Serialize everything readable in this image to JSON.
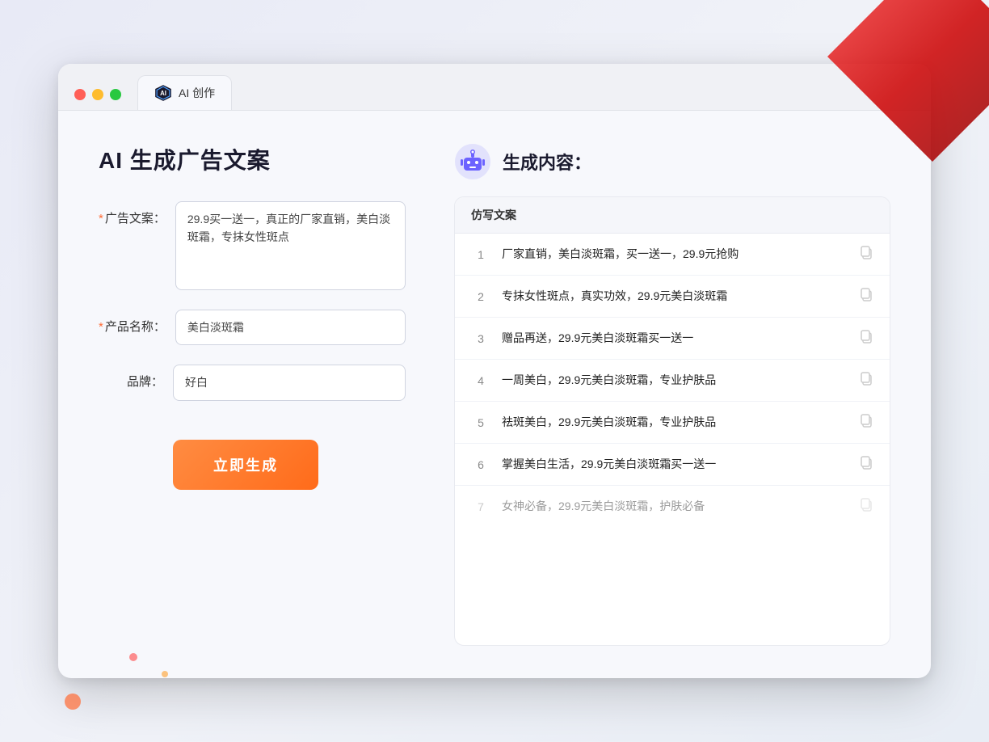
{
  "browser": {
    "tab_title": "AI 创作",
    "traffic_lights": [
      "red",
      "yellow",
      "green"
    ]
  },
  "left_panel": {
    "page_title": "AI 生成广告文案",
    "form": {
      "ad_copy_label": "广告文案：",
      "ad_copy_required": "*",
      "ad_copy_value": "29.9买一送一，真正的厂家直销，美白淡斑霜，专抹女性斑点",
      "product_name_label": "产品名称：",
      "product_name_required": "*",
      "product_name_value": "美白淡斑霜",
      "brand_label": "品牌：",
      "brand_value": "好白"
    },
    "generate_button": "立即生成"
  },
  "right_panel": {
    "title": "生成内容：",
    "table_header": "仿写文案",
    "results": [
      {
        "number": "1",
        "text": "厂家直销，美白淡斑霜，买一送一，29.9元抢购",
        "faded": false
      },
      {
        "number": "2",
        "text": "专抹女性斑点，真实功效，29.9元美白淡斑霜",
        "faded": false
      },
      {
        "number": "3",
        "text": "赠品再送，29.9元美白淡斑霜买一送一",
        "faded": false
      },
      {
        "number": "4",
        "text": "一周美白，29.9元美白淡斑霜，专业护肤品",
        "faded": false
      },
      {
        "number": "5",
        "text": "祛斑美白，29.9元美白淡斑霜，专业护肤品",
        "faded": false
      },
      {
        "number": "6",
        "text": "掌握美白生活，29.9元美白淡斑霜买一送一",
        "faded": false
      },
      {
        "number": "7",
        "text": "女神必备，29.9元美白淡斑霜，护肤必备",
        "faded": true
      }
    ]
  }
}
